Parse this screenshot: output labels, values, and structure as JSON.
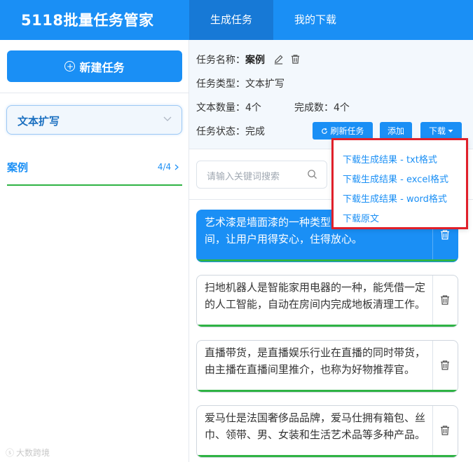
{
  "app": {
    "title": "5118批量任务管家"
  },
  "tabs": [
    {
      "label": "生成任务",
      "active": true
    },
    {
      "label": "我的下载",
      "active": false
    }
  ],
  "sidebar": {
    "new_task_label": "新建任务",
    "type_select": {
      "value": "文本扩写"
    },
    "tasks": [
      {
        "name": "案例",
        "count": "4/4"
      }
    ]
  },
  "task_info": {
    "name_label": "任务名称：",
    "name_value": "案例",
    "type_label": "任务类型：",
    "type_value": "文本扩写",
    "count_label": "文本数量：",
    "count_value": "4个",
    "done_label": "完成数：",
    "done_value": "4个",
    "status_label": "任务状态：",
    "status_value": "完成"
  },
  "buttons": {
    "refresh": "刷新任务",
    "add": "添加",
    "download": "下载"
  },
  "search": {
    "placeholder": "请输入关键词搜索"
  },
  "items": [
    {
      "text": "艺术漆是墙面漆的一种类型，有较高要求的空间，让用户用得安心，住得放心。"
    },
    {
      "text": "扫地机器人是智能家用电器的一种，能凭借一定的人工智能，自动在房间内完成地板清理工作。"
    },
    {
      "text": "直播带货，是直播娱乐行业在直播的同时带货，由主播在直播间里推介，也称为好物推荐官。"
    },
    {
      "text": "爱马仕是法国奢侈品品牌，爱马仕拥有箱包、丝巾、领带、男、女装和生活艺术品等多种产品。"
    }
  ],
  "dropdown": [
    {
      "label": "下载生成结果 - txt格式"
    },
    {
      "label": "下载生成结果 - excel格式"
    },
    {
      "label": "下载生成结果 - word格式"
    },
    {
      "label": "下载原文"
    }
  ],
  "watermark": "大数跨境"
}
